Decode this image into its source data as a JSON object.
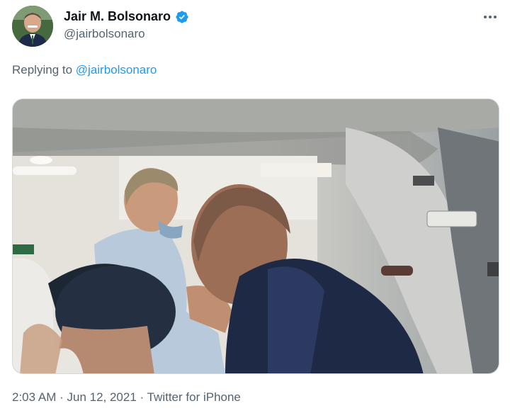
{
  "author": {
    "display_name": "Jair M. Bolsonaro",
    "handle": "@jairbolsonaro",
    "verified": true
  },
  "reply": {
    "prefix": "Replying to ",
    "mention": "@jairbolsonaro"
  },
  "media": {
    "kind": "video-frame"
  },
  "meta": {
    "time": "2:03 AM",
    "separator": " · ",
    "date": "Jun 12, 2021",
    "source": "Twitter for iPhone"
  },
  "colors": {
    "accent": "#1d9bf0",
    "muted": "#536471",
    "text": "#0f1419"
  },
  "icons": {
    "verified": "verified-badge-icon",
    "more": "more-horizontal-icon"
  }
}
